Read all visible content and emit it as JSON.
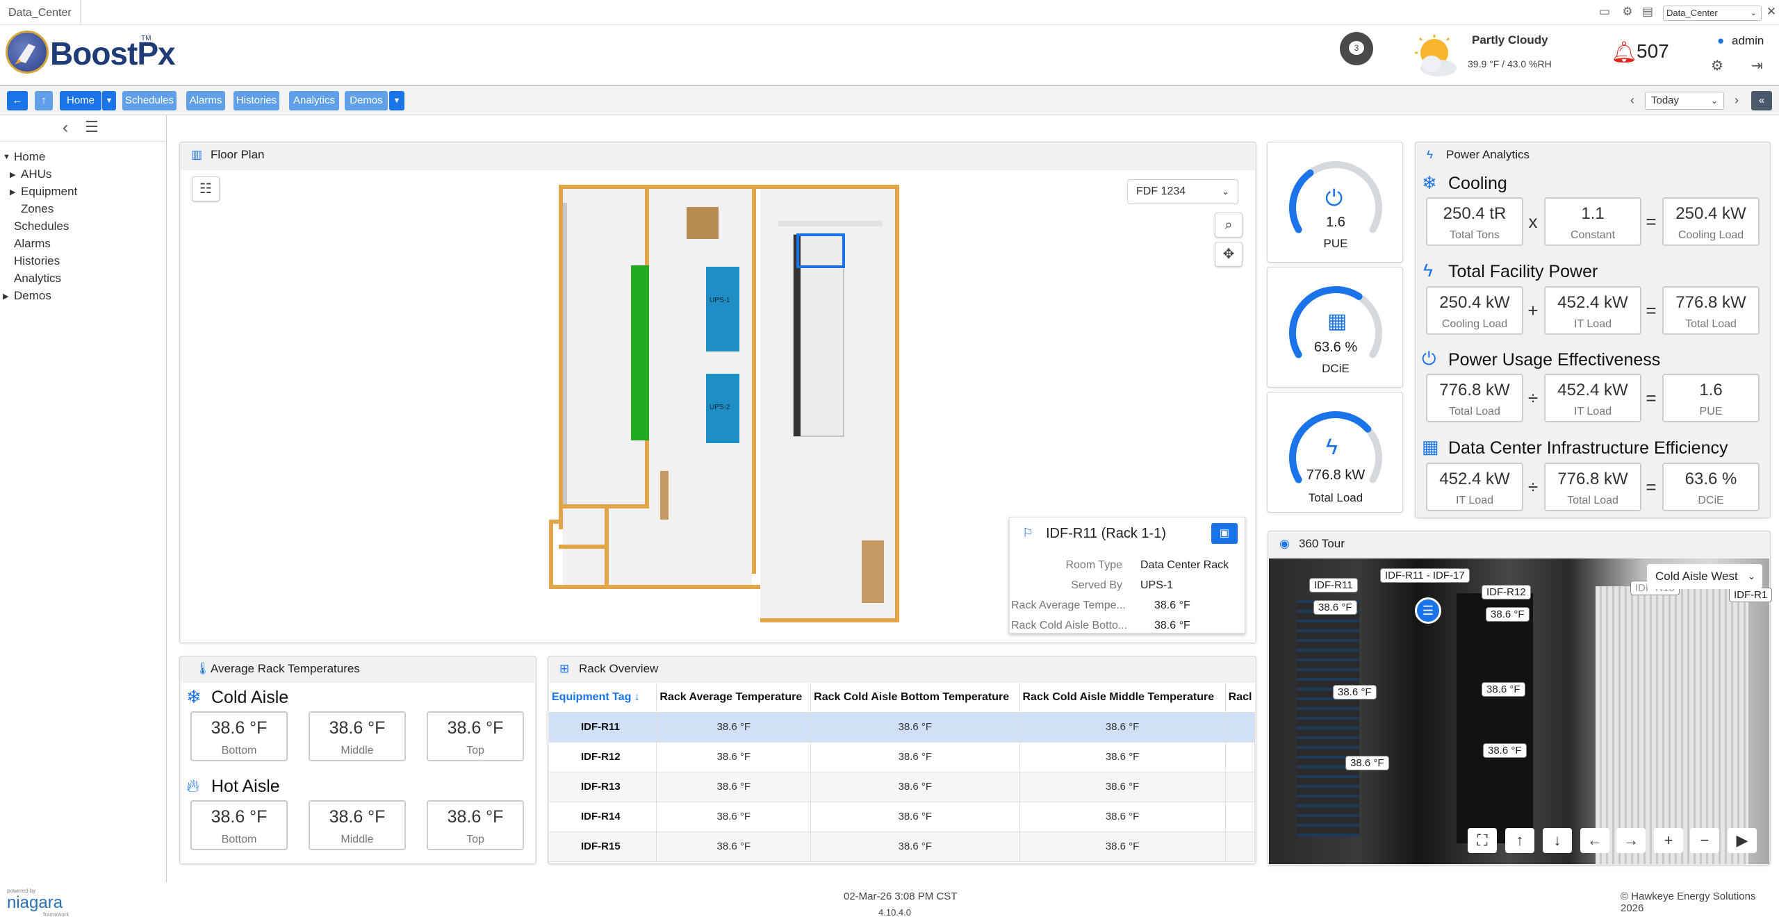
{
  "window": {
    "tab_title": "Data_Center",
    "station_select": "Data_Center"
  },
  "header": {
    "brand": "BoostPx",
    "brand_tm": "TM",
    "notifications_count": "3",
    "weather_title": "Partly Cloudy",
    "weather_detail": "39.9 °F / 43.0 %RH",
    "alarm_count": "507",
    "user": "admin"
  },
  "nav": {
    "home": "Home",
    "schedules": "Schedules",
    "alarms": "Alarms",
    "histories": "Histories",
    "analytics": "Analytics",
    "demos": "Demos",
    "date_range": "Today"
  },
  "tree": {
    "home": "Home",
    "ahus": "AHUs",
    "equipment": "Equipment",
    "zones": "Zones",
    "schedules": "Schedules",
    "alarms": "Alarms",
    "histories": "Histories",
    "analytics": "Analytics",
    "demos": "Demos"
  },
  "floorplan": {
    "title": "Floor Plan",
    "select": "FDF 1234",
    "ups1": "UPS-1",
    "ups2": "UPS-2",
    "rack": {
      "title": "IDF-R11 (Rack 1-1)",
      "rows": [
        {
          "label": "Room Type",
          "value": "Data Center Rack"
        },
        {
          "label": "Served By",
          "value": "UPS-1"
        },
        {
          "label": "Rack Average Tempe...",
          "value": "38.6 °F"
        },
        {
          "label": "Rack Cold Aisle Botto...",
          "value": "38.6 °F"
        }
      ]
    }
  },
  "gauges": [
    {
      "value": "1.6",
      "label": "PUE",
      "fraction": 0.35
    },
    {
      "value": "63.6 %",
      "label": "DCiE",
      "fraction": 0.636
    },
    {
      "value": "776.8 kW",
      "label": "Total Load",
      "fraction": 0.7
    }
  ],
  "power": {
    "title": "Power Analytics",
    "cooling": {
      "title": "Cooling",
      "a": {
        "v": "250.4 tR",
        "l": "Total Tons"
      },
      "op": "x",
      "b": {
        "v": "1.1",
        "l": "Constant"
      },
      "c": {
        "v": "250.4 kW",
        "l": "Cooling Load"
      }
    },
    "facility": {
      "title": "Total Facility Power",
      "a": {
        "v": "250.4 kW",
        "l": "Cooling Load"
      },
      "op": "+",
      "b": {
        "v": "452.4 kW",
        "l": "IT Load"
      },
      "c": {
        "v": "776.8 kW",
        "l": "Total Load"
      }
    },
    "pue": {
      "title": "Power Usage Effectiveness",
      "a": {
        "v": "776.8 kW",
        "l": "Total Load"
      },
      "op": "÷",
      "b": {
        "v": "452.4 kW",
        "l": "IT Load"
      },
      "c": {
        "v": "1.6",
        "l": "PUE"
      }
    },
    "dcie": {
      "title": "Data Center Infrastructure Efficiency",
      "a": {
        "v": "452.4 kW",
        "l": "IT Load"
      },
      "op": "÷",
      "b": {
        "v": "776.8 kW",
        "l": "Total Load"
      },
      "c": {
        "v": "63.6 %",
        "l": "DCiE"
      }
    },
    "eq": "="
  },
  "temps": {
    "title": "Average Rack Temperatures",
    "cold": {
      "title": "Cold Aisle",
      "items": [
        {
          "v": "38.6 °F",
          "l": "Bottom"
        },
        {
          "v": "38.6 °F",
          "l": "Middle"
        },
        {
          "v": "38.6 °F",
          "l": "Top"
        }
      ]
    },
    "hot": {
      "title": "Hot Aisle",
      "items": [
        {
          "v": "38.6 °F",
          "l": "Bottom"
        },
        {
          "v": "38.6 °F",
          "l": "Middle"
        },
        {
          "v": "38.6 °F",
          "l": "Top"
        }
      ]
    }
  },
  "rack_overview": {
    "title": "Rack Overview",
    "columns": [
      "Equipment Tag",
      "Rack Average Temperature",
      "Rack Cold Aisle Bottom Temperature",
      "Rack Cold Aisle Middle Temperature",
      "Racl"
    ],
    "rows": [
      [
        "IDF-R11",
        "38.6 °F",
        "38.6 °F",
        "38.6 °F"
      ],
      [
        "IDF-R12",
        "38.6 °F",
        "38.6 °F",
        "38.6 °F"
      ],
      [
        "IDF-R13",
        "38.6 °F",
        "38.6 °F",
        "38.6 °F"
      ],
      [
        "IDF-R14",
        "38.6 °F",
        "38.6 °F",
        "38.6 °F"
      ],
      [
        "IDF-R15",
        "38.6 °F",
        "38.6 °F",
        "38.6 °F"
      ]
    ]
  },
  "tour": {
    "title": "360 Tour",
    "view_select": "Cold Aisle West",
    "hotspot_main": "IDF-R11 - IDF-17",
    "labels": [
      "IDF-R11",
      "38.6 °F",
      "IDF-R12",
      "38.6 °F",
      "IDF-R13",
      "IDF-R1",
      "38.6 °F",
      "38.6 °F",
      "38.6 °F",
      "38.6 °F"
    ]
  },
  "footer": {
    "timestamp": "02-Mar-26 3:08 PM CST",
    "version": "4.10.4.0",
    "copyright": "© Hawkeye Energy Solutions 2026",
    "niagara": "niagara",
    "powered": "powered by",
    "framework": "framework"
  }
}
